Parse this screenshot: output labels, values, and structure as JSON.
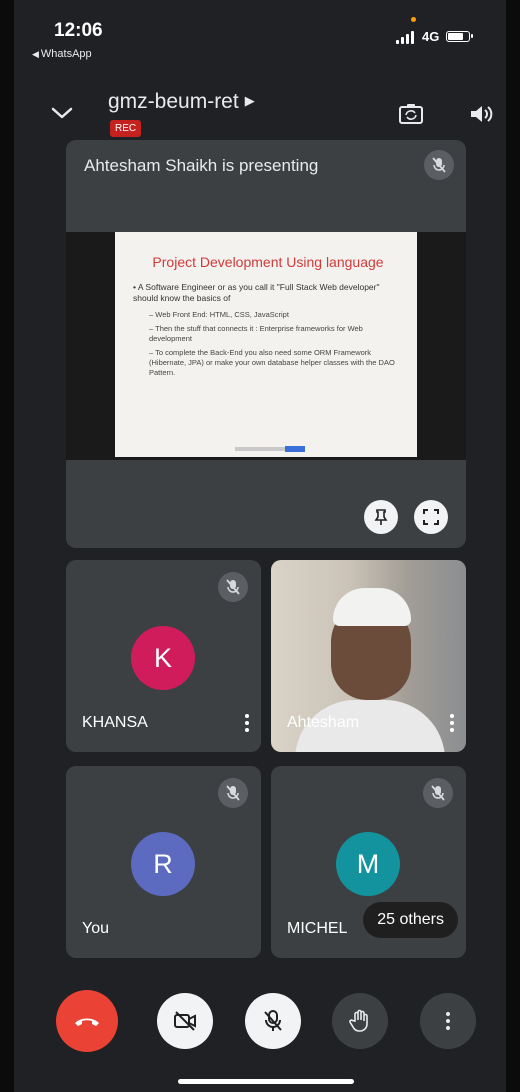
{
  "status_bar": {
    "time": "12:06",
    "back_app": "WhatsApp",
    "network": "4G"
  },
  "meeting": {
    "title": "gmz-beum-ret",
    "rec_badge": "REC"
  },
  "presentation": {
    "label": "Ahtesham Shaikh is presenting",
    "slide": {
      "title": "Project Development Using language",
      "bullet": "A Software Engineer  or as you call it \"Full Stack Web developer\" should know the basics of",
      "sub_items": [
        "Web Front End: HTML, CSS, JavaScript",
        "Then the stuff that connects it : Enterprise frameworks for Web development",
        "To complete the Back-End you also need some ORM Framework (Hibernate, JPA) or make your own database helper classes with the DAO Pattern."
      ]
    }
  },
  "participants": [
    {
      "name": "KHANSA",
      "initial": "K",
      "avatar_color": "#d01c5a"
    },
    {
      "name": "Ahtesham",
      "initial": "",
      "avatar_color": ""
    },
    {
      "name": "You",
      "initial": "R",
      "avatar_color": "#5c6bc0"
    },
    {
      "name": "MICHEL",
      "initial": "M",
      "avatar_color": "#12939e"
    }
  ],
  "others_label": "25 others",
  "icons": {
    "hangup": "phone-hangup-icon",
    "camera_off": "camera-off-icon",
    "mic_off": "mic-off-icon",
    "raise_hand": "hand-icon",
    "more": "more-vert-icon"
  },
  "colors": {
    "hangup_red": "#ea4335",
    "rec_red": "#c5221f"
  }
}
